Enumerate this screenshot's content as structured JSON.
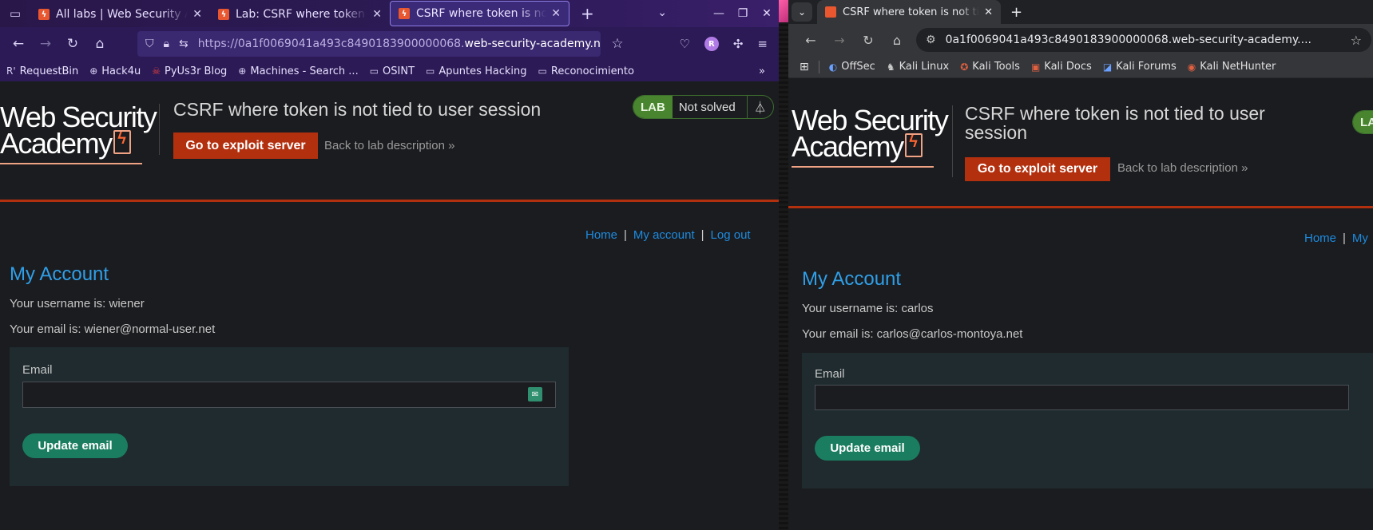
{
  "left": {
    "tabs": [
      {
        "title": "All labs | Web Security Academy"
      },
      {
        "title": "Lab: CSRF where token is not tied to user session"
      },
      {
        "title": "CSRF where token is not tied to user session"
      }
    ],
    "url_prefix": "https://0a1f0069041a493c8490183900000068.",
    "url_host": "web-security-academy.net",
    "avatar_letter": "R",
    "bookmarks": [
      "RequestBin",
      "Hack4u",
      "PyUs3r Blog",
      "Machines - Search ...",
      "OSINT",
      "Apuntes Hacking",
      "Reconocimiento"
    ],
    "page": {
      "logo_line1": "Web Security",
      "logo_line2": "Academy",
      "lab_title": "CSRF where token is not tied to user session",
      "exploit_button": "Go to exploit server",
      "back_link": "Back to lab description",
      "badge_lab": "LAB",
      "badge_status": "Not solved",
      "nav_home": "Home",
      "nav_account": "My account",
      "nav_logout": "Log out",
      "heading": "My Account",
      "username_line": "Your username is: wiener",
      "email_line": "Your email is: wiener@normal-user.net",
      "email_label": "Email",
      "email_value": "",
      "update_button": "Update email"
    }
  },
  "right": {
    "tab_title": "CSRF where token is not tied to user session",
    "omnibox": "0a1f0069041a493c8490183900000068.web-security-academy....",
    "bookmarks": [
      "OffSec",
      "Kali Linux",
      "Kali Tools",
      "Kali Docs",
      "Kali Forums",
      "Kali NetHunter"
    ],
    "page": {
      "logo_line1": "Web Security",
      "logo_line2": "Academy",
      "lab_title_line1": "CSRF where token is not tied to user",
      "lab_title_line2": "session",
      "exploit_button": "Go to exploit server",
      "back_link": "Back to lab description",
      "badge_lab": "LA",
      "nav_home": "Home",
      "nav_account_partial": "My",
      "heading": "My Account",
      "username_line": "Your username is: carlos",
      "email_line": "Your email is: carlos@carlos-montoya.net",
      "email_label": "Email",
      "email_value": "",
      "update_button": "Update email"
    }
  },
  "colors": {
    "firefox_chrome": "#2b1a55",
    "lab_red": "#b3300f",
    "link_blue": "#1d8be0",
    "heading_blue": "#2f9fe8",
    "update_green": "#1b7d5f",
    "lab_green": "#49852f",
    "panel_bg": "#1f2b2f"
  }
}
